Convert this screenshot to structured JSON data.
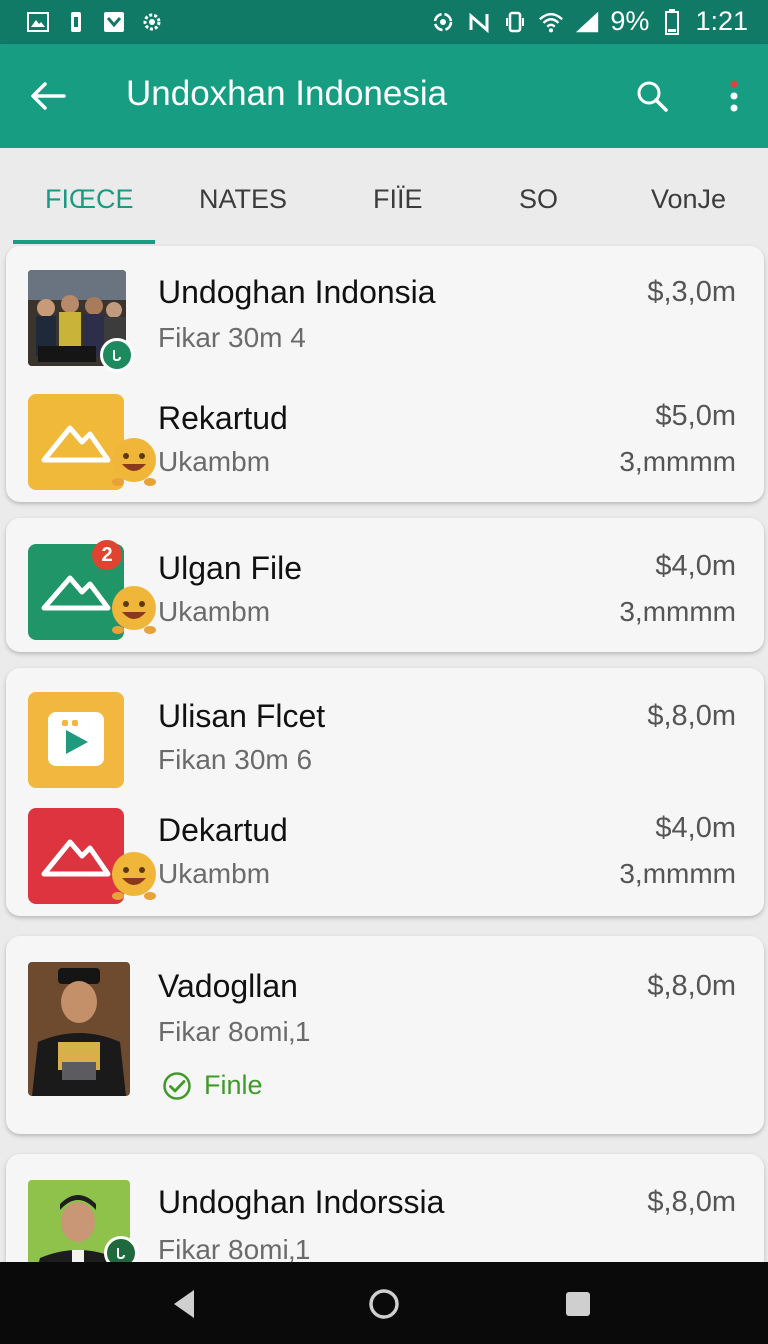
{
  "status_bar": {
    "battery_percent": "9%",
    "time": "1:21",
    "left_icons": [
      "gallery-icon",
      "sim-icon",
      "download-check-icon",
      "settings-icon"
    ],
    "right_icons": [
      "sync-icon",
      "mute-icon",
      "vibrate-icon",
      "wifi-icon",
      "signal-icon",
      "battery-icon"
    ]
  },
  "app_bar": {
    "title": "Undoxhan Indonesia",
    "color": "#179d82"
  },
  "tabs": [
    {
      "label": "FIŒCE",
      "active": true
    },
    {
      "label": "NATES",
      "active": false
    },
    {
      "label": "FIÏE",
      "active": false
    },
    {
      "label": "SO",
      "active": false
    },
    {
      "label": "VonJe",
      "active": false
    }
  ],
  "cards": [
    {
      "rows": [
        {
          "name": "Undoghan Indonsia",
          "sub": "Fikar 30m 4",
          "price": "$,3,0m",
          "size": "",
          "thumb": "group-photo"
        },
        {
          "name": "Rekartud",
          "sub": "Ukambm",
          "price": "$5,0m",
          "size": "3,mmmm",
          "thumb": "gallery-app-orange"
        }
      ]
    },
    {
      "rows": [
        {
          "name": "Ulgan File",
          "sub": "Ukambm",
          "price": "$4,0m",
          "size": "3,mmmm",
          "thumb": "gallery-app-green",
          "badge": "2"
        }
      ]
    },
    {
      "rows": [
        {
          "name": "Ulisan Flcet",
          "sub": "Fikan 30m 6",
          "price": "$,8,0m",
          "size": "",
          "thumb": "video-app-orange"
        },
        {
          "name": "Dekartud",
          "sub": "Ukambm",
          "price": "$4,0m",
          "size": "3,mmmm",
          "thumb": "gallery-app-red"
        }
      ]
    },
    {
      "rows": [
        {
          "name": "Vadogllan",
          "sub": "Fikar 8omi‚1",
          "price": "$,8,0m",
          "size": "",
          "thumb": "portrait-photo",
          "status": "Finle"
        }
      ]
    },
    {
      "rows": [
        {
          "name": "Undoghan Indorssia",
          "sub": "Fikar 8omi‚1",
          "price": "$,8,0m",
          "size": "",
          "thumb": "portrait-green"
        }
      ]
    }
  ],
  "nav_bar": [
    "back-triangle-icon",
    "home-circle-icon",
    "recents-square-icon"
  ]
}
